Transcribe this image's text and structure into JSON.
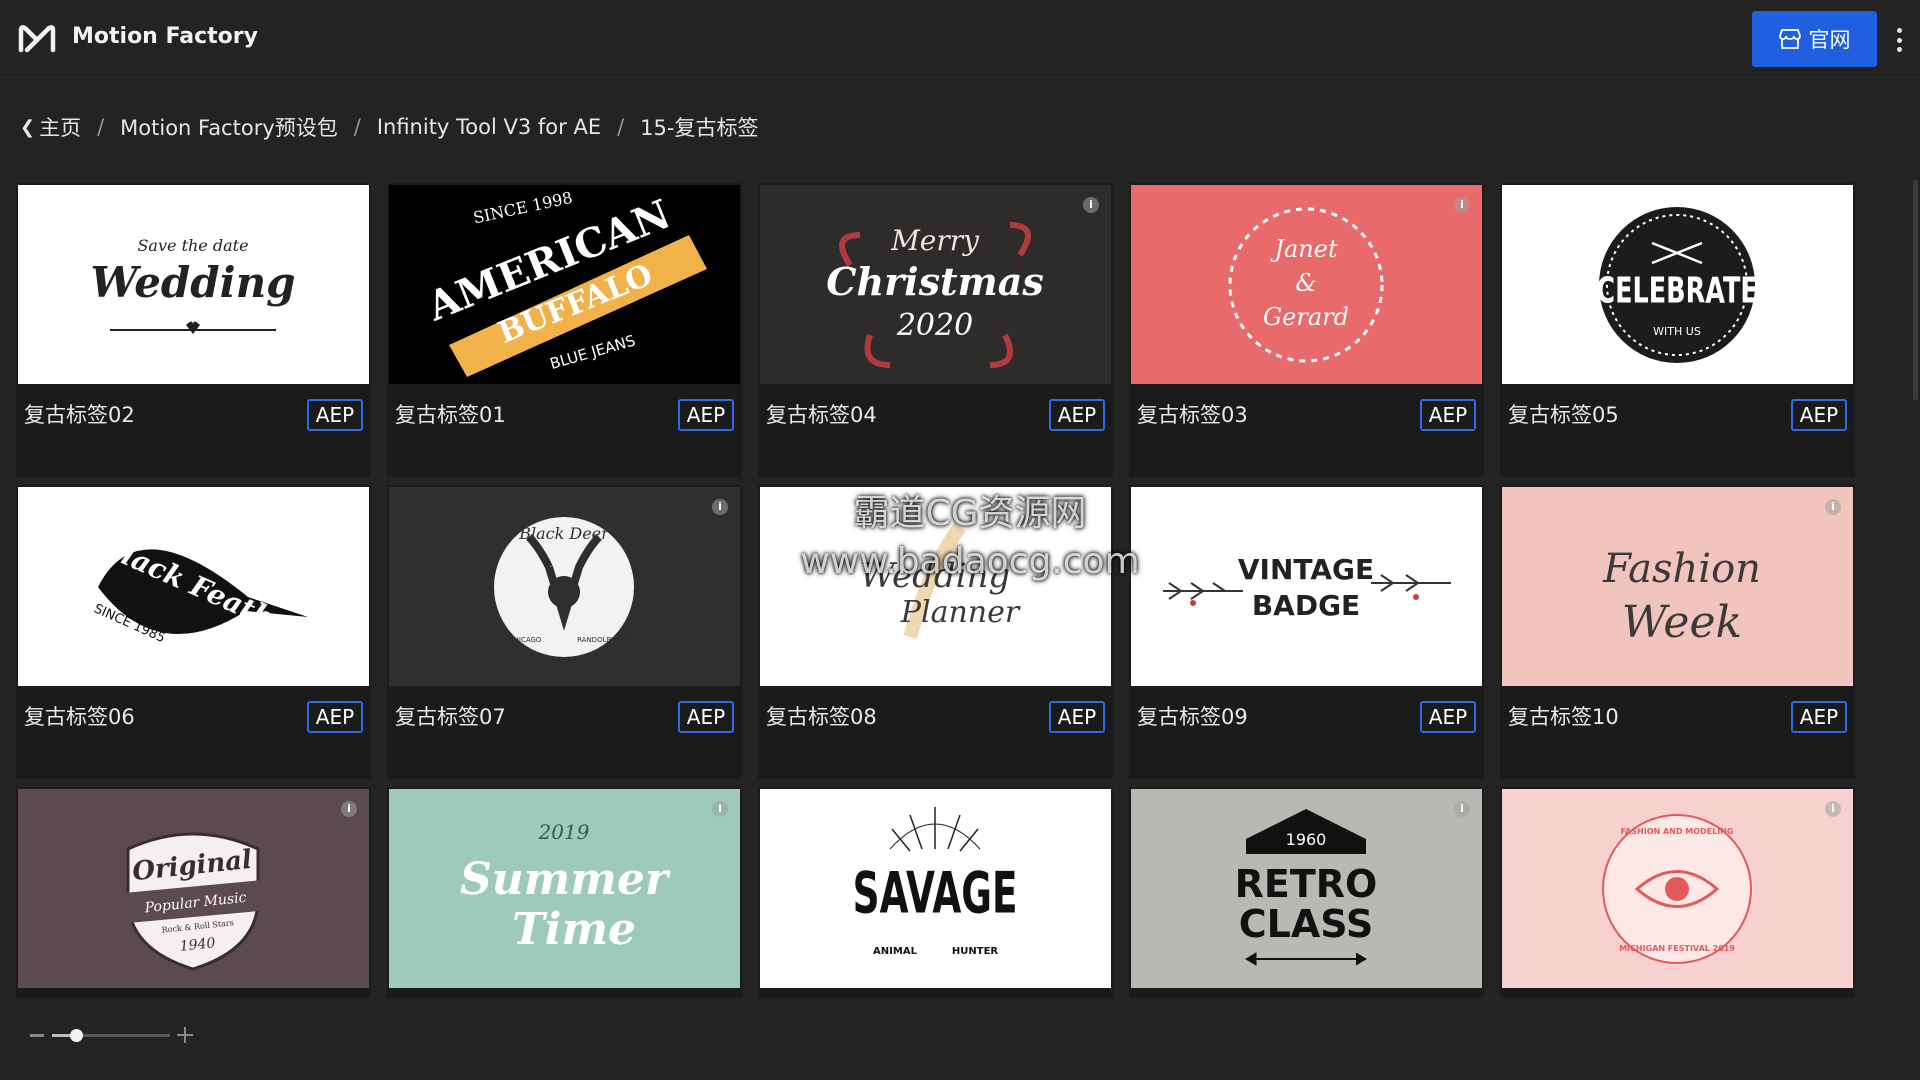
{
  "app": {
    "title": "Motion Factory",
    "logo_icon": "mf-logo-icon"
  },
  "header": {
    "site_button_label": "官网",
    "site_button_icon": "store-icon",
    "accent": "#1f5fe0"
  },
  "breadcrumb": {
    "items": [
      "主页",
      "Motion Factory预设包",
      "Infinity Tool V3 for AE",
      "15-复古标签"
    ],
    "separator": "/"
  },
  "thumbnails": {
    "wedding": {
      "line1": "Save the date",
      "line2": "Wedding"
    },
    "buffalo": {
      "top": "SINCE 1998",
      "line1": "AMERICAN",
      "line2": "BUFFALO",
      "bottom": "BLUE JEANS"
    },
    "christmas": {
      "line1": "Merry",
      "line2": "Christmas",
      "line3": "2020"
    },
    "janet": {
      "line1": "Janet",
      "line2": "&",
      "line3": "Gerard"
    },
    "celebrate": {
      "line1": "CELEBRATE",
      "line2": "WITH US"
    },
    "feather": {
      "line1": "Black Feather",
      "line2": "SINCE 1985"
    },
    "deer": {
      "line1": "Black Deer",
      "left": "THE CHICAGO",
      "right": "RANDOLPH STREET"
    },
    "planner": {
      "line1": "Wedding",
      "line2": "Planner"
    },
    "vintage": {
      "line1": "VINTAGE",
      "line2": "BADGE"
    },
    "fashion": {
      "line1": "Fashion",
      "line2": "Week"
    },
    "original": {
      "line1": "Original",
      "line2": "Popular Music",
      "line3": "Rock & Roll Stars",
      "line4": "1940"
    },
    "summer": {
      "line1": "2019",
      "line2": "Summer",
      "line3": "Time"
    },
    "savage": {
      "line1": "SAVAGE",
      "left": "ANIMAL",
      "right": "HUNTER"
    },
    "retro": {
      "line1": "1960",
      "line2": "RETRO",
      "line3": "CLASS"
    },
    "eye": {
      "top": "FASHION AND MODELING",
      "bottom": "MICHIGAN FESTIVAL 2019"
    }
  },
  "cards": [
    {
      "title": "复古标签02",
      "badge": "AEP"
    },
    {
      "title": "复古标签01",
      "badge": "AEP"
    },
    {
      "title": "复古标签04",
      "badge": "AEP"
    },
    {
      "title": "复古标签03",
      "badge": "AEP"
    },
    {
      "title": "复古标签05",
      "badge": "AEP"
    },
    {
      "title": "复古标签06",
      "badge": "AEP"
    },
    {
      "title": "复古标签07",
      "badge": "AEP"
    },
    {
      "title": "复古标签08",
      "badge": "AEP"
    },
    {
      "title": "复古标签09",
      "badge": "AEP"
    },
    {
      "title": "复古标签10",
      "badge": "AEP"
    }
  ],
  "watermark": {
    "line1": "霸道CG资源网",
    "line2": "www.badaocg.com"
  },
  "zoom": {
    "value": 0.2
  }
}
